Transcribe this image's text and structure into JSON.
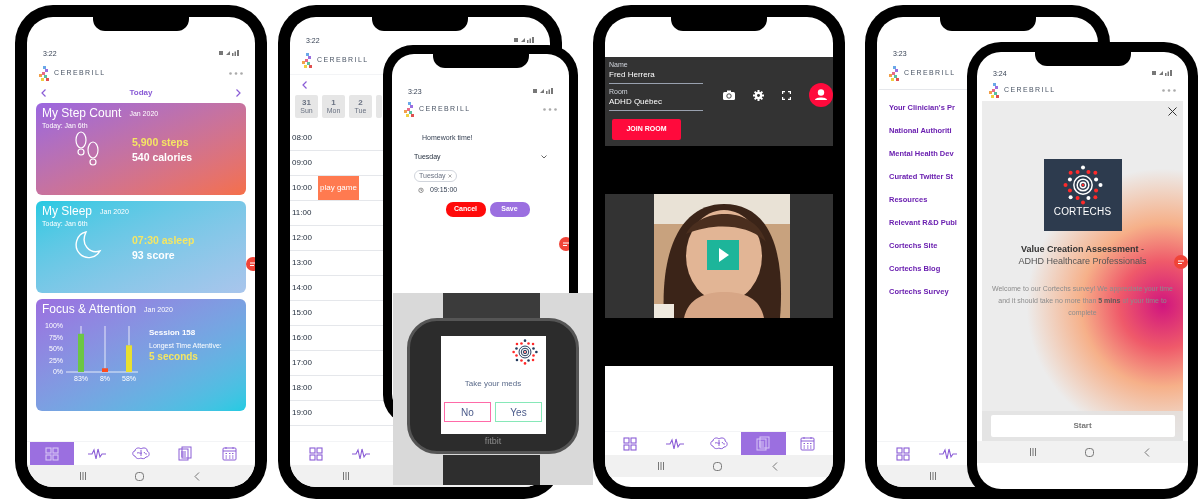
{
  "screens": [
    {
      "kind": "dashboard",
      "time": "3:22",
      "brand": "CEREBRILL",
      "date_label": "Today",
      "cards": [
        {
          "kind": "steps",
          "title": "My Step Count",
          "period": "Jan 2020",
          "subtitle": "Today: Jan 6th",
          "primary": "5,900 steps",
          "secondary": "540 calories"
        },
        {
          "kind": "sleep",
          "title": "My Sleep",
          "period": "Jan 2020",
          "subtitle": "Today: Jan 6th",
          "primary": "07:30 asleep",
          "secondary": "93 score"
        },
        {
          "kind": "focus",
          "title": "Focus & Attention",
          "period": "Jan 2020",
          "session": "Session 158",
          "caption": "Longest Time Attentive:",
          "primary": "5 seconds",
          "chart_data": {
            "type": "bar",
            "categories": [
              "83%",
              "8%",
              "58%"
            ],
            "values": [
              83,
              8,
              58
            ],
            "grid": true,
            "ylim": [
              0,
              100
            ],
            "yticks": [
              {
                "value": 0,
                "label": "0%"
              },
              {
                "value": 25,
                "label": "25%"
              },
              {
                "value": 50,
                "label": "50%"
              },
              {
                "value": 75,
                "label": "75%"
              },
              {
                "value": 100,
                "label": "100%"
              }
            ]
          }
        }
      ],
      "tabs": [
        {
          "kind": "grid",
          "selected": true
        },
        {
          "kind": "pulse",
          "selected": false
        },
        {
          "kind": "brain",
          "selected": false
        },
        {
          "kind": "documents",
          "selected": false
        },
        {
          "kind": "calendar",
          "selected": false
        }
      ]
    },
    {
      "kind": "calendar",
      "time": "3:22",
      "brand": "CEREBRILL",
      "days": [
        {
          "date": "31",
          "weekday": "Sun"
        },
        {
          "date": "1",
          "weekday": "Mon"
        },
        {
          "date": "2",
          "weekday": "Tue"
        }
      ],
      "hours": [
        {
          "time": "08:00"
        },
        {
          "time": "09:00"
        },
        {
          "time": "10:00",
          "event": "play game"
        },
        {
          "time": "11:00"
        },
        {
          "time": "12:00"
        },
        {
          "time": "13:00"
        },
        {
          "time": "14:00"
        },
        {
          "time": "15:00"
        },
        {
          "time": "16:00"
        },
        {
          "time": "17:00"
        },
        {
          "time": "18:00"
        },
        {
          "time": "19:00"
        }
      ],
      "tabs": [
        {
          "kind": "grid",
          "selected": false
        },
        {
          "kind": "pulse",
          "selected": false
        }
      ]
    },
    {
      "kind": "reminder",
      "time": "3:23",
      "brand": "CEREBRILL",
      "message": "Homework time!",
      "day_select": "Tuesday",
      "chips": [
        "Tuesday"
      ],
      "alarm_time": "09:15:00",
      "buttons": [
        {
          "kind": "cancel",
          "label": "Cancel"
        },
        {
          "kind": "save",
          "label": "Save"
        }
      ]
    },
    {
      "kind": "watch",
      "prompt": "Take your meds",
      "buttons": [
        {
          "kind": "no",
          "label": "No"
        },
        {
          "kind": "yes",
          "label": "Yes"
        }
      ],
      "device_label": "fitbit"
    },
    {
      "kind": "video_room",
      "fields": [
        {
          "label": "Name",
          "value": "Fred Herrera"
        },
        {
          "label": "Room",
          "value": "ADHD Québec"
        }
      ],
      "join_button": "JOIN ROOM",
      "tabs": [
        {
          "kind": "grid",
          "selected": false
        },
        {
          "kind": "pulse",
          "selected": false
        },
        {
          "kind": "brain",
          "selected": false
        },
        {
          "kind": "documents",
          "selected": true
        },
        {
          "kind": "calendar",
          "selected": false
        }
      ]
    },
    {
      "kind": "links",
      "time": "3:23",
      "brand": "CEREBRILL",
      "links": [
        "Your Clinician's Pr",
        "National Authoriti",
        "Mental Health Dev",
        "Curated Twitter St",
        "Resources",
        "Relevant R&D Publ",
        "Cortechs Site",
        "Cortechs Blog",
        "Cortechs Survey"
      ],
      "tabs": [
        {
          "kind": "grid",
          "selected": false
        },
        {
          "kind": "pulse",
          "selected": false
        }
      ]
    },
    {
      "kind": "survey",
      "time": "3:24",
      "brand": "CEREBRILL",
      "logo_text": "CORTECHS",
      "title": "**Value Creation Assessment** -",
      "subtitle": "ADHD Healthcare Professionals",
      "body": "Welcome to our Cortechs survey! We appreciate your time and it should take no more than **5 mins** of your time to complete",
      "start_button": "Start"
    }
  ]
}
